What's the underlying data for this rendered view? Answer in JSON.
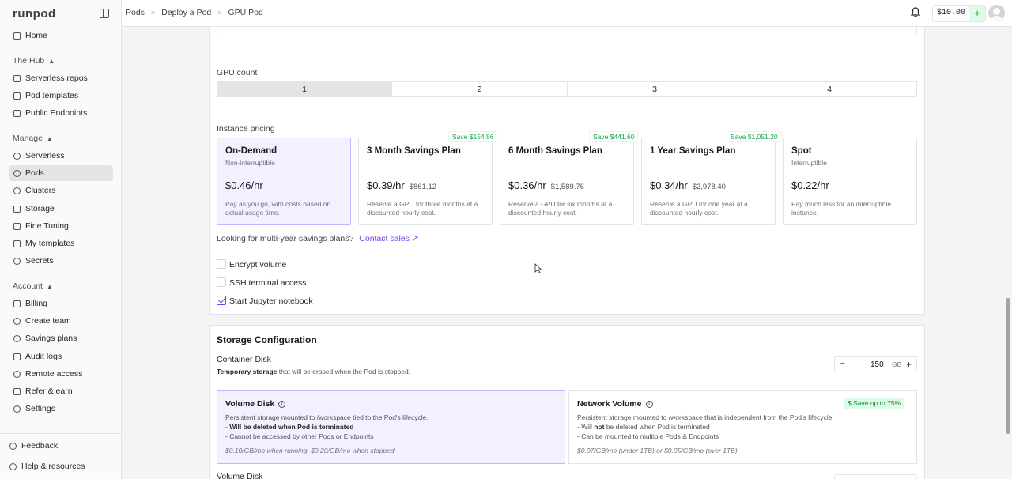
{
  "app": {
    "logo": "runpod"
  },
  "sidebar": {
    "home": "Home",
    "hub_label": "The Hub",
    "hub_items": [
      "Serverless repos",
      "Pod templates",
      "Public Endpoints"
    ],
    "manage_label": "Manage",
    "manage_items": [
      "Serverless",
      "Pods",
      "Clusters",
      "Storage",
      "Fine Tuning",
      "My templates",
      "Secrets"
    ],
    "account_label": "Account",
    "account_items": [
      "Billing",
      "Create team",
      "Savings plans",
      "Audit logs",
      "Remote access",
      "Refer & earn",
      "Settings"
    ],
    "feedback": "Feedback",
    "help": "Help & resources"
  },
  "breadcrumb": [
    "Pods",
    "Deploy a Pod",
    "GPU Pod"
  ],
  "header": {
    "balance": "$10.00",
    "add_funds": "+"
  },
  "gpu_count": {
    "label": "GPU count",
    "options": [
      "1",
      "2",
      "3",
      "4"
    ],
    "selected": "1"
  },
  "pricing": {
    "label": "Instance pricing",
    "plans": [
      {
        "title": "On-Demand",
        "subtitle": "Non-interruptible",
        "price": "$0.46/hr",
        "total": "",
        "desc": "Pay as you go, with costs based on actual usage time.",
        "badge": ""
      },
      {
        "title": "3 Month Savings Plan",
        "subtitle": "",
        "price": "$0.39/hr",
        "total": "$861.12",
        "desc": "Reserve a GPU for three months at a discounted hourly cost.",
        "badge": "Save $154.56"
      },
      {
        "title": "6 Month Savings Plan",
        "subtitle": "",
        "price": "$0.36/hr",
        "total": "$1,589.76",
        "desc": "Reserve a GPU for six months at a discounted hourly cost.",
        "badge": "Save $441.60"
      },
      {
        "title": "1 Year Savings Plan",
        "subtitle": "",
        "price": "$0.34/hr",
        "total": "$2,978.40",
        "desc": "Reserve a GPU for one year at a discounted hourly cost.",
        "badge": "Save $1,051.20"
      },
      {
        "title": "Spot",
        "subtitle": "Interruptible",
        "price": "$0.22/hr",
        "total": "",
        "desc": "Pay much less for an interruptible instance.",
        "badge": ""
      }
    ],
    "multi_year_text": "Looking for multi-year savings plans?",
    "contact_sales": "Contact sales"
  },
  "options": {
    "encrypt_volume": "Encrypt volume",
    "ssh_access": "SSH terminal access",
    "jupyter": "Start Jupyter notebook"
  },
  "storage": {
    "title": "Storage Configuration",
    "container_disk_label": "Container Disk",
    "container_disk_desc_bold": "Temporary storage",
    "container_disk_desc_rest": " that will be erased when the Pod is stopped.",
    "container_disk_value": "150",
    "container_disk_unit": "GB",
    "volume_disk": {
      "title": "Volume Disk",
      "desc": "Persistent storage mounted to /workspace tied to the Pod's lifecycle.",
      "bullet1": "- Will be deleted when Pod is terminated",
      "bullet2": "- Cannot be accessed by other Pods or Endpoints",
      "pricing": "$0.10/GB/mo when running, $0.20/GB/mo when stopped"
    },
    "network_volume": {
      "title": "Network Volume",
      "desc": "Persistent storage mounted to /workspace that is independent from the Pod's lifecycle.",
      "bullet1_pre": "- Will ",
      "bullet1_bold": "not",
      "bullet1_post": " be deleted when Pod is terminated",
      "bullet2": "- Can be mounted to multiple Pods & Endpoints",
      "pricing": "$0.07/GB/mo (under 1TB) or $0.05/GB/mo (over 1TB)",
      "badge": "Save up to 75%"
    },
    "volume_disk_label_bottom": "Volume Disk"
  }
}
